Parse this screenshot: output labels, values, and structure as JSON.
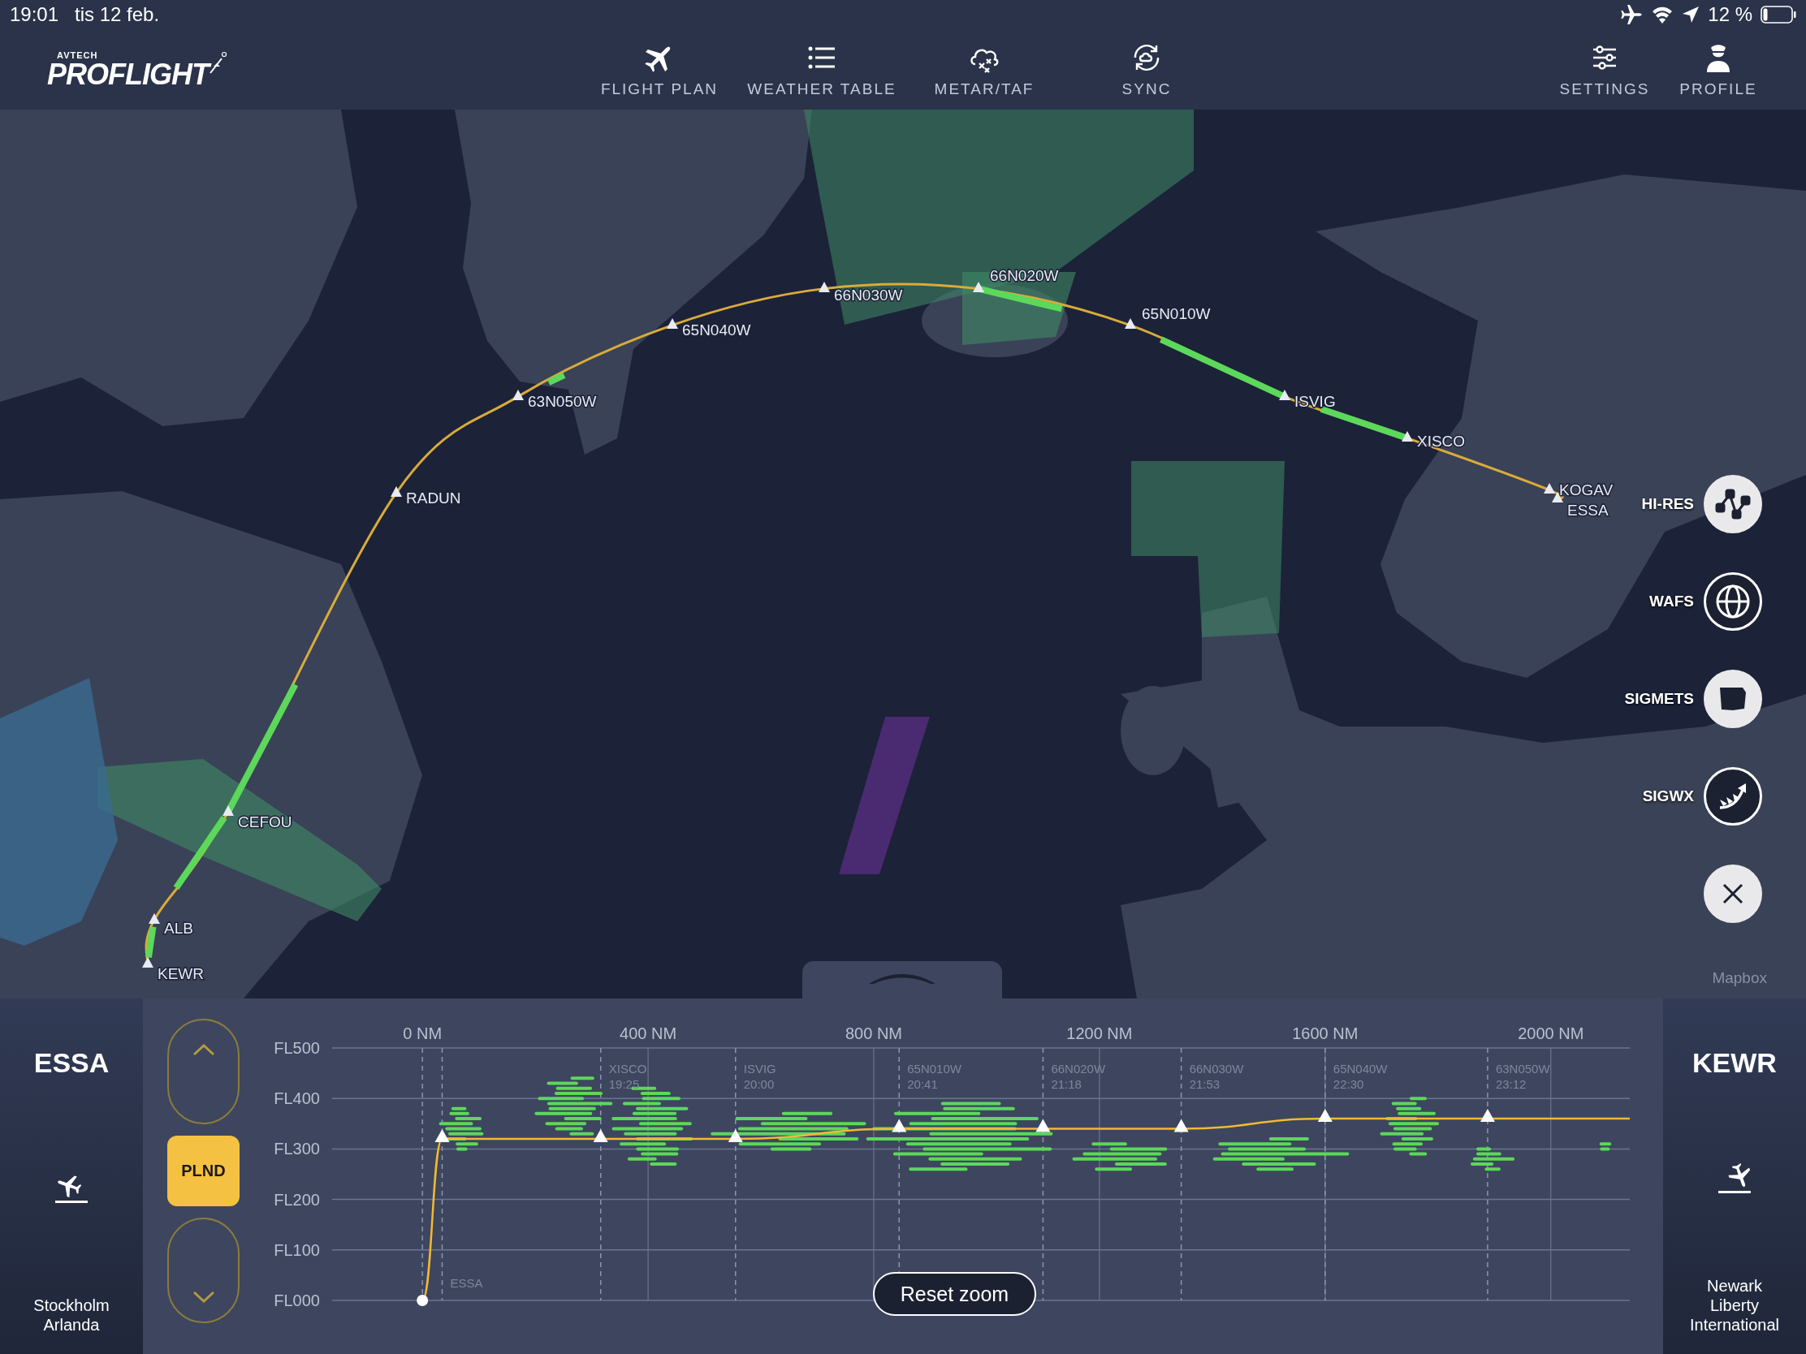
{
  "status_bar": {
    "time": "19:01",
    "date": "tis 12 feb.",
    "battery": "12 %"
  },
  "header": {
    "logo": {
      "brand": "AVTECH",
      "name": "PROFLIGHT"
    },
    "nav": [
      {
        "label": "FLIGHT PLAN",
        "kind": "plane"
      },
      {
        "label": "WEATHER TABLE",
        "kind": "list"
      },
      {
        "label": "METAR/TAF",
        "kind": "cloud"
      },
      {
        "label": "SYNC",
        "kind": "sync"
      }
    ],
    "account": [
      {
        "label": "SETTINGS",
        "kind": "sliders"
      },
      {
        "label": "PROFILE",
        "kind": "pilot"
      }
    ]
  },
  "map": {
    "kind": "picture",
    "waypoints": [
      {
        "name": "KEWR"
      },
      {
        "name": "ALB"
      },
      {
        "name": "CEFOU"
      },
      {
        "name": "RADUN"
      },
      {
        "name": "63N050W"
      },
      {
        "name": "65N040W"
      },
      {
        "name": "66N030W"
      },
      {
        "name": "66N020W"
      },
      {
        "name": "65N010W"
      },
      {
        "name": "ISVIG"
      },
      {
        "name": "XISCO"
      },
      {
        "name": "KOGAV"
      },
      {
        "name": "ESSA"
      }
    ],
    "layers": [
      {
        "label": "HI-RES",
        "kind": "hires",
        "on": false
      },
      {
        "label": "WAFS",
        "kind": "wafs",
        "on": true
      },
      {
        "label": "SIGMETS",
        "kind": "sigmets",
        "on": false
      },
      {
        "label": "SIGWX",
        "kind": "sigwx",
        "on": true
      }
    ],
    "attribution": "Mapbox"
  },
  "profile": {
    "departure": {
      "code": "ESSA",
      "name": "Stockholm Arlanda"
    },
    "mode": "PLND",
    "distance_labels": [
      "0 NM",
      "400 NM",
      "800 NM",
      "1200 NM",
      "1600 NM",
      "2000 NM"
    ],
    "waypoint_labels": [
      "ESSA",
      "XISCO\n19:25",
      "ISVIG\n20:00",
      "65N010W\n20:41",
      "66N020W\n21:18",
      "66N030W\n21:53",
      "65N040W\n22:30",
      "63N050W\n23:12"
    ],
    "altitude_labels": [
      "FL500",
      "FL400",
      "FL300",
      "FL200",
      "FL100",
      "FL000"
    ],
    "reset_button": "Reset zoom",
    "arrival": {
      "code": "KEWR",
      "name": "Newark Liberty International"
    }
  }
}
